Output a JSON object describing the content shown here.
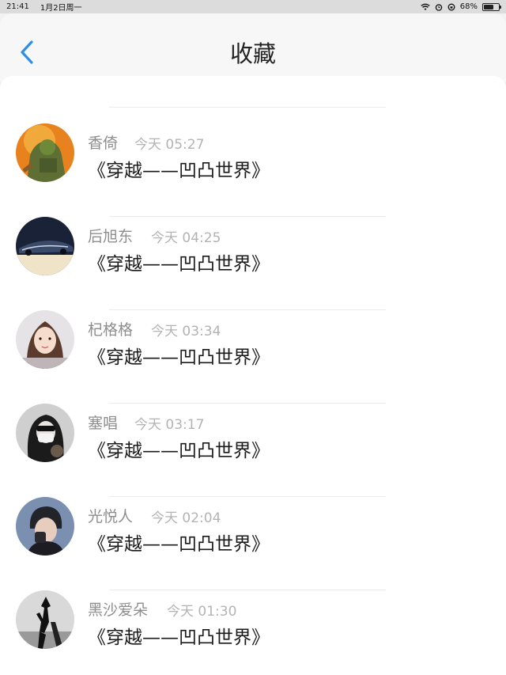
{
  "status_bar": {
    "time": "21:41",
    "date": "1月2日周一",
    "battery": "68%",
    "battery_level": 0.68
  },
  "header": {
    "title": "收藏",
    "back_icon": "chevron-left-icon",
    "accent_color": "#2f8fe6"
  },
  "items": [
    {
      "username": "",
      "time": "",
      "message": ""
    },
    {
      "username": "香倚",
      "time": "今天 05:27",
      "message": "《穿越——凹凸世界》"
    },
    {
      "username": "后旭东",
      "time": "今天 04:25",
      "message": "《穿越——凹凸世界》"
    },
    {
      "username": "杞格格",
      "time": "今天 03:34",
      "message": "《穿越——凹凸世界》"
    },
    {
      "username": "塞唱",
      "time": "今天 03:17",
      "message": "《穿越——凹凸世界》"
    },
    {
      "username": "光悦人",
      "time": "今天 02:04",
      "message": "《穿越——凹凸世界》"
    },
    {
      "username": "黑沙爱朵",
      "time": "今天 01:30",
      "message": "《穿越——凹凸世界》"
    }
  ]
}
